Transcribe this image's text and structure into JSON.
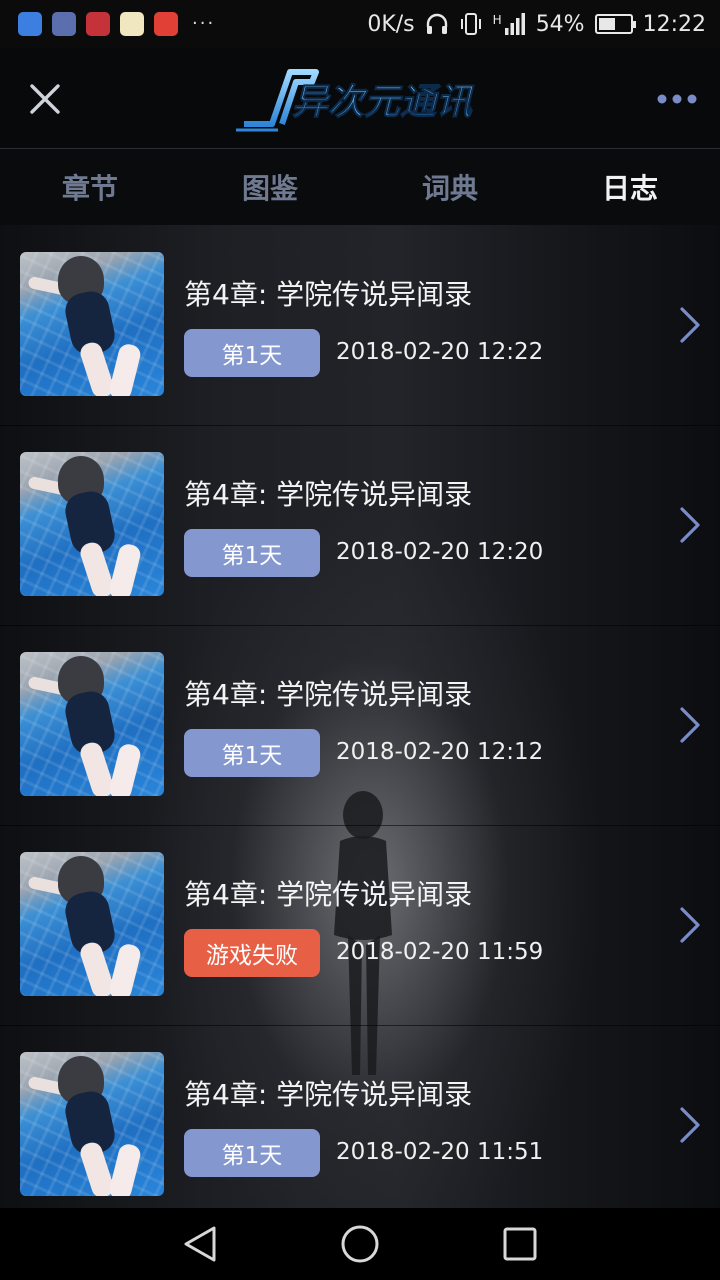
{
  "status_bar": {
    "network_speed": "0K/s",
    "signal_type": "H",
    "battery_percent": "54%",
    "battery_level": 0.54,
    "time": "12:22",
    "notification_icons": [
      "qq-icon",
      "game-icon",
      "red-app-icon",
      "score-app-icon",
      "music-icon"
    ],
    "overflow": "···"
  },
  "app_bar": {
    "logo_text": "异次元通讯",
    "close_icon": "close-icon",
    "more_icon": "more-dots-icon"
  },
  "tabs": [
    {
      "label": "章节",
      "active": false
    },
    {
      "label": "图鉴",
      "active": false
    },
    {
      "label": "词典",
      "active": false
    },
    {
      "label": "日志",
      "active": true
    }
  ],
  "log_entries": [
    {
      "title": "第4章: 学院传说异闻录",
      "badge": "第1天",
      "badge_type": "day",
      "datetime": "2018-02-20 12:22"
    },
    {
      "title": "第4章: 学院传说异闻录",
      "badge": "第1天",
      "badge_type": "day",
      "datetime": "2018-02-20 12:20"
    },
    {
      "title": "第4章: 学院传说异闻录",
      "badge": "第1天",
      "badge_type": "day",
      "datetime": "2018-02-20 12:12"
    },
    {
      "title": "第4章: 学院传说异闻录",
      "badge": "游戏失败",
      "badge_type": "fail",
      "datetime": "2018-02-20 11:59"
    },
    {
      "title": "第4章: 学院传说异闻录",
      "badge": "第1天",
      "badge_type": "day",
      "datetime": "2018-02-20 11:51"
    }
  ],
  "colors": {
    "badge_day": "#8497cf",
    "badge_fail": "#e76045",
    "tab_inactive": "#6f7a92",
    "tab_active": "#f2f2f2"
  },
  "nav_bar": {
    "back_icon": "back-triangle-icon",
    "home_icon": "home-circle-icon",
    "recents_icon": "recents-square-icon"
  }
}
